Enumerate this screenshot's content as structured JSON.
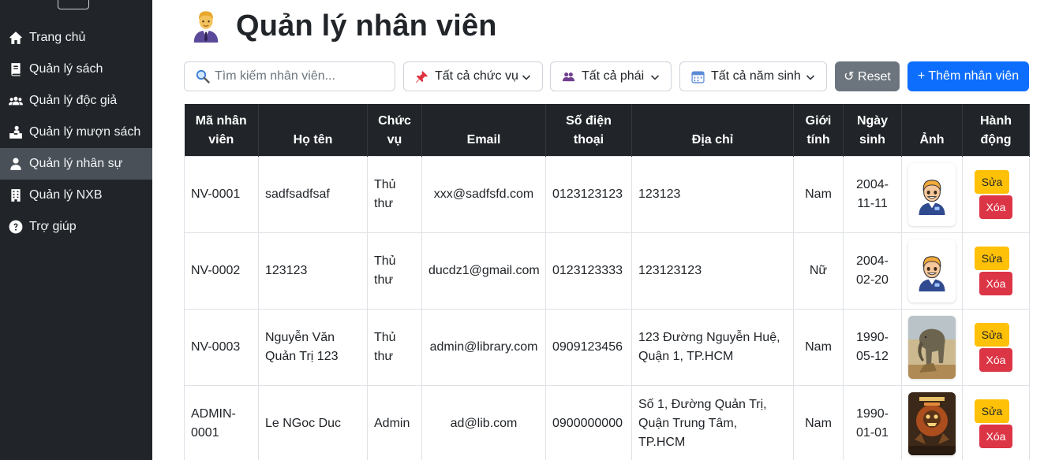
{
  "sidebar": {
    "items": [
      {
        "label": "Trang chủ",
        "icon": "home-icon"
      },
      {
        "label": "Quản lý sách",
        "icon": "book-icon"
      },
      {
        "label": "Quản lý độc giả",
        "icon": "users-icon"
      },
      {
        "label": "Quản lý mượn sách",
        "icon": "borrow-icon"
      },
      {
        "label": "Quản lý nhân sự",
        "icon": "user-icon",
        "active": true
      },
      {
        "label": "Quản lý NXB",
        "icon": "building-icon"
      },
      {
        "label": "Trợ giúp",
        "icon": "help-icon"
      }
    ]
  },
  "header": {
    "title": "Quản lý nhân viên",
    "icon": "office-worker-emoji-icon"
  },
  "toolbar": {
    "search_placeholder": "Tìm kiếm nhân viên...",
    "filter_role": "Tất cả chức vụ",
    "filter_gender": "Tất cả phái",
    "filter_year": "Tất cả năm sinh",
    "reset_label": "↺ Reset",
    "add_label": "+ Thêm nhân viên"
  },
  "table": {
    "headers": [
      "Mã nhân viên",
      "Họ tên",
      "Chức vụ",
      "Email",
      "Số điện thoại",
      "Địa chỉ",
      "Giới tính",
      "Ngày sinh",
      "Ảnh",
      "Hành động"
    ],
    "rows": [
      {
        "id": "NV-0001",
        "name": "sadfsadfsaf",
        "role": "Thủ thư",
        "email": "xxx@sadfsfd.com",
        "phone": "0123123123",
        "address": "123123",
        "gender": "Nam",
        "dob": "2004-11-11",
        "photo": "cartoon-avatar",
        "edit": "Sửa",
        "delete": "Xóa"
      },
      {
        "id": "NV-0002",
        "name": "123123",
        "role": "Thủ thư",
        "email": "ducdz1@gmail.com",
        "phone": "0123123333",
        "address": "123123123",
        "gender": "Nữ",
        "dob": "2004-02-20",
        "photo": "cartoon-avatar",
        "edit": "Sửa",
        "delete": "Xóa"
      },
      {
        "id": "NV-0003",
        "name": "Nguyễn Văn Quản Trị 123",
        "role": "Thủ thư",
        "email": "admin@library.com",
        "phone": "0909123456",
        "address": "123 Đường Nguyễn Huệ, Quận 1, TP.HCM",
        "gender": "Nam",
        "dob": "1990-05-12",
        "photo": "elephant-photo",
        "edit": "Sửa",
        "delete": "Xóa"
      },
      {
        "id": "ADMIN-0001",
        "name": "Le NGoc Duc",
        "role": "Admin",
        "email": "ad@lib.com",
        "phone": "0900000000",
        "address": "Số 1, Đường Quản Trị, Quận Trung Tâm, TP.HCM",
        "gender": "Nam",
        "dob": "1990-01-01",
        "photo": "physics-book-cover",
        "edit": "Sửa",
        "delete": "Xóa"
      }
    ]
  },
  "colors": {
    "sidebar_bg": "#212529",
    "active_bg": "#495057",
    "primary": "#0d6efd",
    "secondary": "#6c757d",
    "warning": "#ffc107",
    "danger": "#dc3545"
  }
}
